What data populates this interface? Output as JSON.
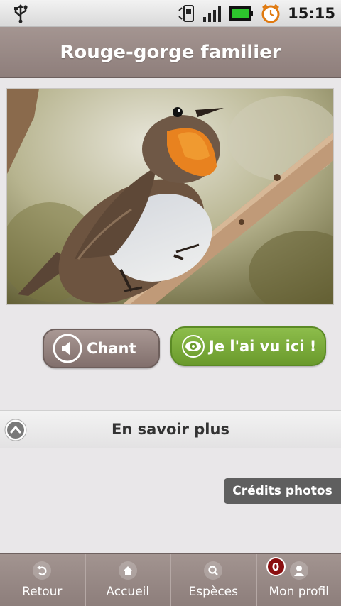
{
  "status_bar": {
    "time": "15:15"
  },
  "header": {
    "title": "Rouge-gorge familier"
  },
  "photo": {
    "subject": "robin-photo"
  },
  "actions": {
    "chant_label": "Chant",
    "seen_label": "Je l'ai vu ici !"
  },
  "more": {
    "label": "En savoir plus"
  },
  "credits": {
    "label": "Crédits photos"
  },
  "nav": {
    "items": [
      {
        "label": "Retour",
        "icon": "back-icon"
      },
      {
        "label": "Accueil",
        "icon": "home-icon"
      },
      {
        "label": "Espèces",
        "icon": "search-icon"
      },
      {
        "label": "Mon profil",
        "icon": "profile-icon",
        "badge": "0"
      }
    ]
  },
  "colors": {
    "title_bar": "#9a8a87",
    "chant_button": "#937f7c",
    "seen_button": "#7aab3a",
    "badge": "#8a0f10"
  }
}
